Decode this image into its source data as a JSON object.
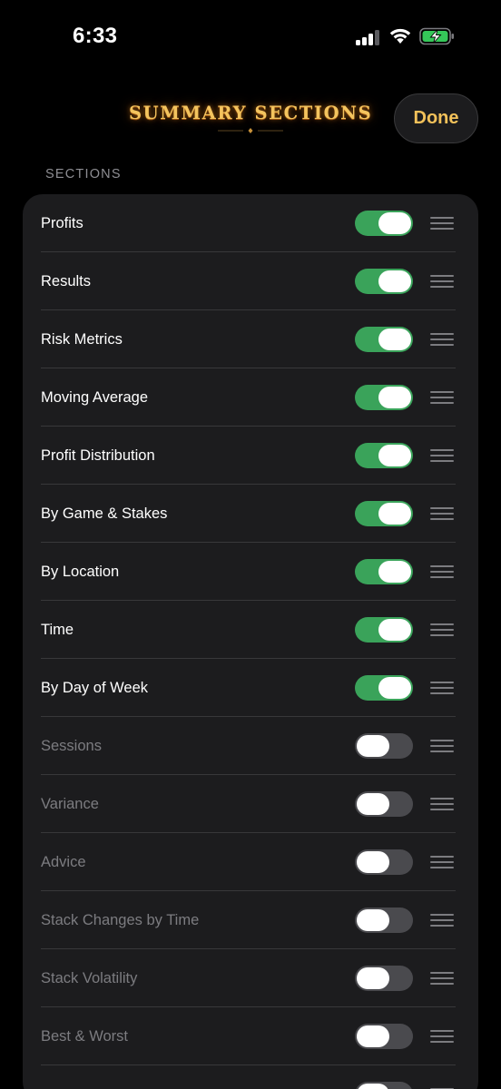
{
  "status_bar": {
    "time": "6:33",
    "signal_icon": "cellular-signal-icon",
    "wifi_icon": "wifi-icon",
    "battery_icon": "battery-charging-icon"
  },
  "header": {
    "title": "SUMMARY SECTIONS",
    "done_label": "Done"
  },
  "section_header": "SECTIONS",
  "colors": {
    "toggle_on": "#3aa35a",
    "toggle_off": "#4a4a4e",
    "accent_gold": "#f2c15a",
    "card_bg": "#1c1c1e"
  },
  "sections": [
    {
      "label": "Profits",
      "enabled": true
    },
    {
      "label": "Results",
      "enabled": true
    },
    {
      "label": "Risk Metrics",
      "enabled": true
    },
    {
      "label": "Moving Average",
      "enabled": true
    },
    {
      "label": "Profit Distribution",
      "enabled": true
    },
    {
      "label": "By Game & Stakes",
      "enabled": true
    },
    {
      "label": "By Location",
      "enabled": true
    },
    {
      "label": "Time",
      "enabled": true
    },
    {
      "label": "By Day of Week",
      "enabled": true
    },
    {
      "label": "Sessions",
      "enabled": false
    },
    {
      "label": "Variance",
      "enabled": false
    },
    {
      "label": "Advice",
      "enabled": false
    },
    {
      "label": "Stack Changes by Time",
      "enabled": false
    },
    {
      "label": "Stack Volatility",
      "enabled": false
    },
    {
      "label": "Best & Worst",
      "enabled": false
    },
    {
      "label": "",
      "enabled": false
    }
  ]
}
